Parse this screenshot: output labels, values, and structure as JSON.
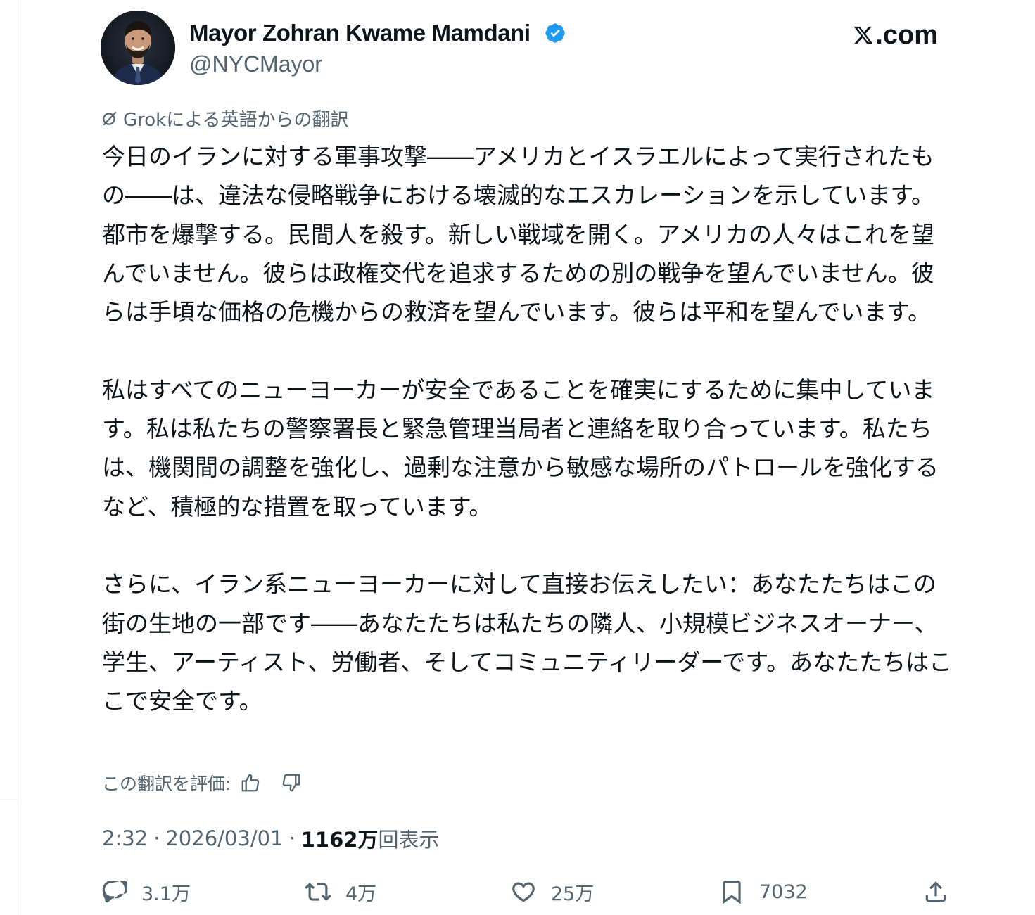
{
  "author": {
    "name": "Mayor Zohran Kwame Mamdani",
    "handle": "@NYCMayor",
    "verified": true
  },
  "site_logo": ".com",
  "translation_note": "Grokによる英語からの翻訳",
  "tweet": {
    "paragraphs": [
      "今日のイランに対する軍事攻撃――アメリカとイスラエルによって実行されたもの――は、違法な侵略戦争における壊滅的なエスカレーションを示しています。都市を爆撃する。民間人を殺す。新しい戦域を開く。アメリカの人々はこれを望んでいません。彼らは政権交代を追求するための別の戦争を望んでいません。彼らは手頃な価格の危機からの救済を望んでいます。彼らは平和を望んでいます。",
      "私はすべてのニューヨーカーが安全であることを確実にするために集中しています。私は私たちの警察署長と緊急管理当局者と連絡を取り合っています。私たちは、機関間の調整を強化し、過剰な注意から敏感な場所のパトロールを強化するなど、積極的な措置を取っています。",
      "さらに、イラン系ニューヨーカーに対して直接お伝えしたい：あなたたちはこの街の生地の一部です――あなたたちは私たちの隣人、小規模ビジネスオーナー、学生、アーティスト、労働者、そしてコミュニティリーダーです。あなたたちはここで安全です。"
    ]
  },
  "rate_translation_label": "この翻訳を評価:",
  "meta": {
    "time": "2:32",
    "date": "2026/03/01",
    "views_count": "1162万",
    "views_label": "回表示",
    "separator": "·"
  },
  "actions": {
    "replies": "3.1万",
    "reposts": "4万",
    "likes": "25万",
    "bookmarks": "7032"
  },
  "colors": {
    "text": "#0f1419",
    "secondary": "#536471",
    "verified": "#1d9bf0",
    "divider": "#eff3f4"
  }
}
